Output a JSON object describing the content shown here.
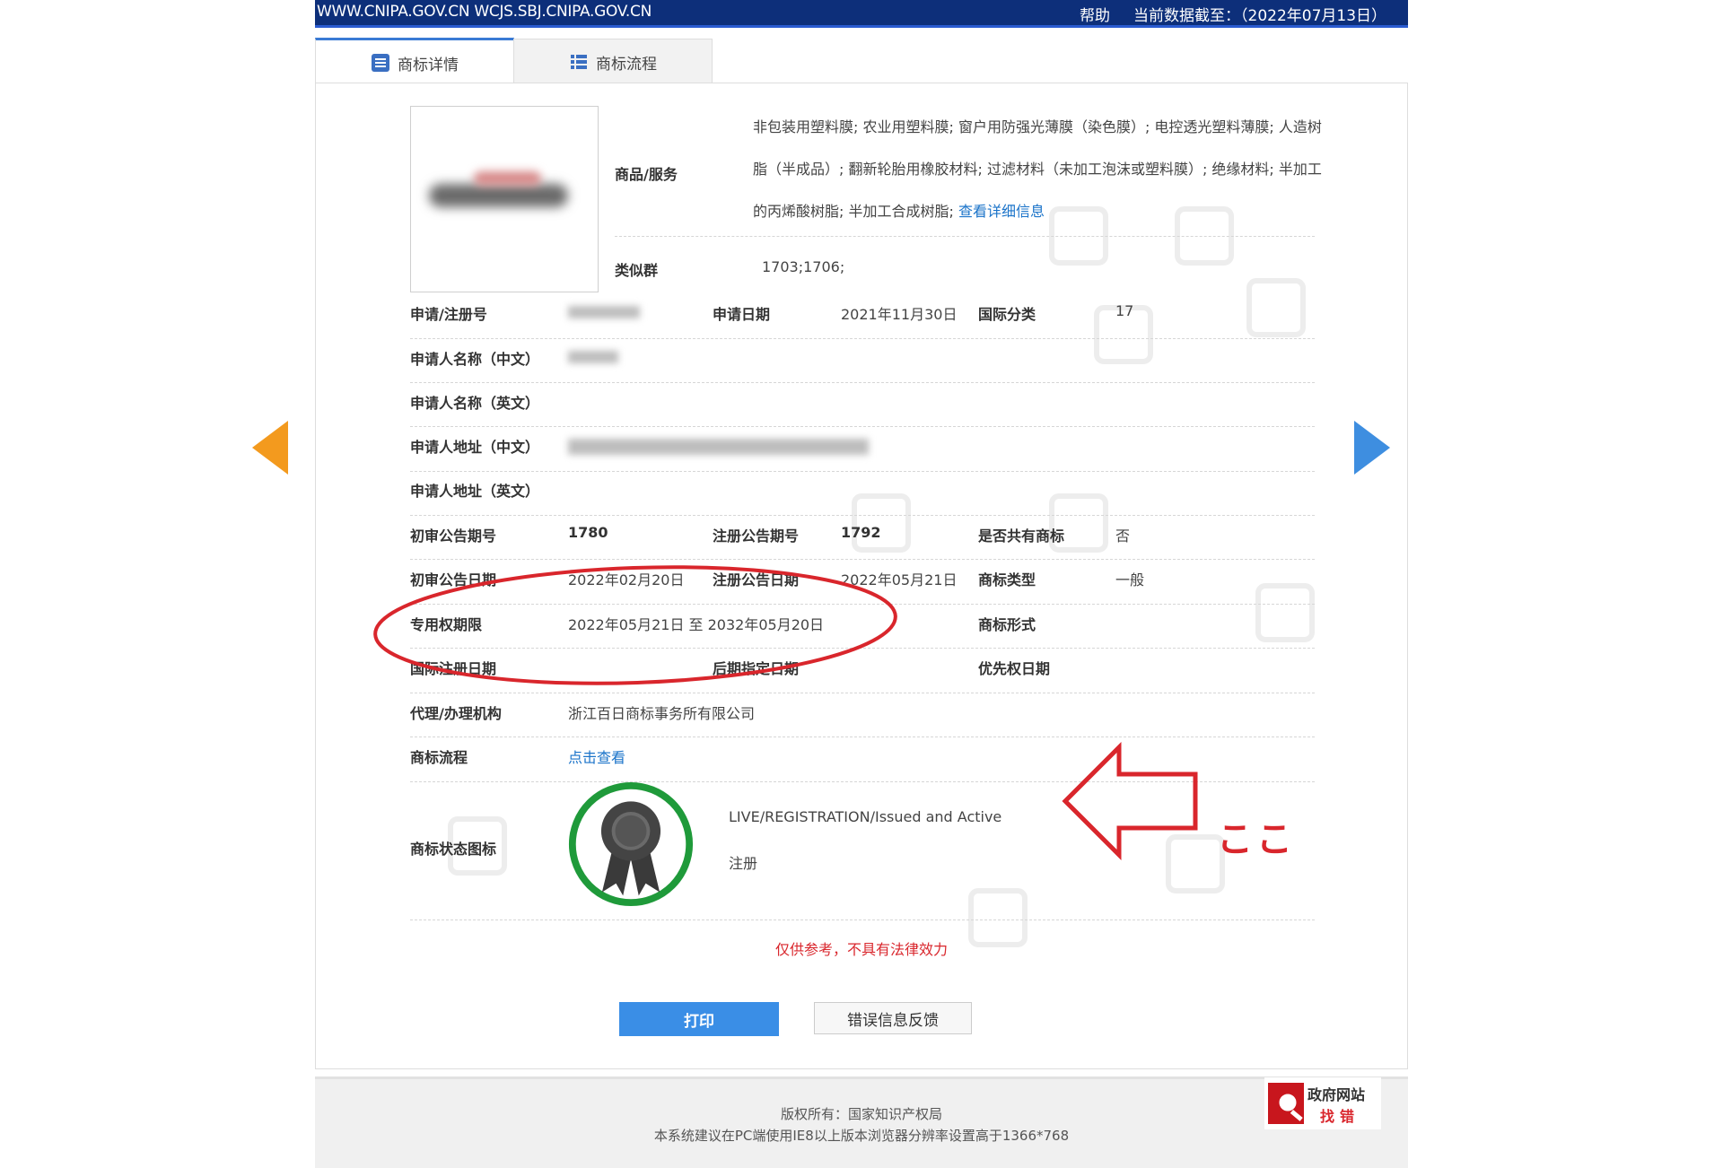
{
  "topbar": {
    "url": "WWW.CNIPA.GOV.CN WCJS.SBJ.CNIPA.GOV.CN",
    "help": "帮助",
    "as_of": "当前数据截至：（2022年07月13日）"
  },
  "tabs": [
    {
      "label": "商标详情",
      "icon": "list-icon"
    },
    {
      "label": "商标流程",
      "icon": "grid-list-icon"
    }
  ],
  "goods": {
    "label": "商品/服务",
    "text": "非包装用塑料膜; 农业用塑料膜; 窗户用防强光薄膜（染色膜）; 电控透光塑料薄膜; 人造树脂（半成品）; 翻新轮胎用橡胶材料; 过滤材料（未加工泡沫或塑料膜）; 绝缘材料; 半加工的丙烯酸树脂; 半加工合成树脂;",
    "more_link": "查看详细信息"
  },
  "similar_group": {
    "label": "类似群",
    "value": "1703;1706;"
  },
  "fields": {
    "reg_no_label": "申请/注册号",
    "apply_date_label": "申请日期",
    "apply_date": "2021年11月30日",
    "intl_class_label": "国际分类",
    "intl_class": "17",
    "applicant_cn_label": "申请人名称（中文）",
    "applicant_en_label": "申请人名称（英文）",
    "address_cn_label": "申请人地址（中文）",
    "address_en_label": "申请人地址（英文）",
    "prelim_issue_label": "初审公告期号",
    "prelim_issue": "1780",
    "reg_issue_label": "注册公告期号",
    "reg_issue": "1792",
    "shared_label": "是否共有商标",
    "shared": "否",
    "prelim_date_label": "初审公告日期",
    "prelim_date": "2022年02月20日",
    "reg_date_label": "注册公告日期",
    "reg_date": "2022年05月21日",
    "mark_type_label": "商标类型",
    "mark_type": "一般",
    "exclusive_label": "专用权期限",
    "exclusive": "2022年05月21日 至 2032年05月20日",
    "mark_form_label": "商标形式",
    "intl_reg_date_label": "国际注册日期",
    "later_designation_label": "后期指定日期",
    "priority_date_label": "优先权日期",
    "agent_label": "代理/办理机构",
    "agent": "浙江百日商标事务所有限公司",
    "process_label": "商标流程",
    "process_link": "点击查看",
    "status_icon_label": "商标状态图标",
    "status_en": "LIVE/REGISTRATION/Issued and Active",
    "status_cn": "注册"
  },
  "disclaimer": "仅供参考，不具有法律效力",
  "buttons": {
    "print": "打印",
    "feedback": "错误信息反馈"
  },
  "footer": {
    "copyright": "版权所有：国家知识产权局",
    "note": "本系统建议在PC端使用IE8以上版本浏览器分辨率设置高于1366*768",
    "badge_line1": "政府网站",
    "badge_line2": "找错"
  },
  "annotation": {
    "text": "ここ"
  },
  "colors": {
    "topbar": "#0d2f7a",
    "link": "#1a73c9",
    "print_button": "#3a8ee6",
    "highlight_red": "#d9262c",
    "seal_green": "#1f9a3a",
    "left_arrow": "#f39a1e",
    "right_arrow": "#3e8ee0"
  }
}
